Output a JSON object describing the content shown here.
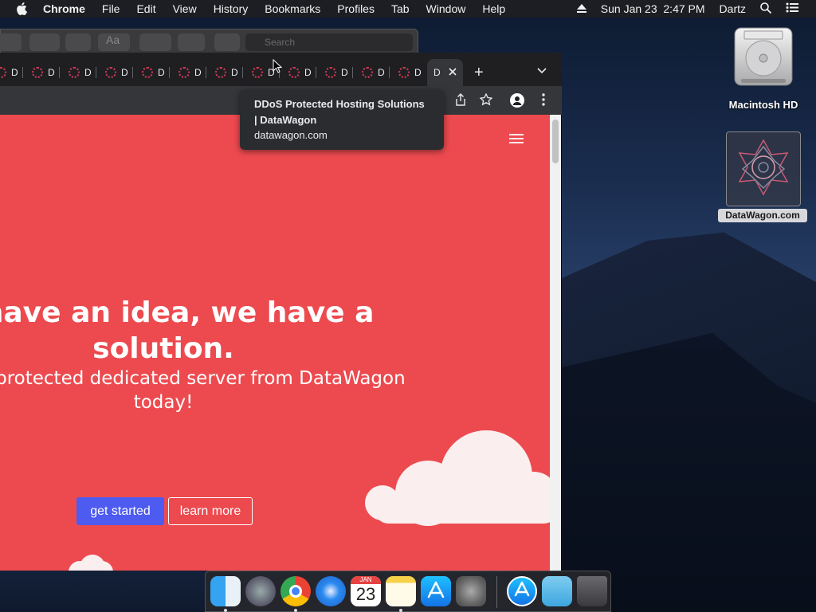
{
  "menubar": {
    "app": "Chrome",
    "items": [
      "File",
      "Edit",
      "View",
      "History",
      "Bookmarks",
      "Profiles",
      "Tab",
      "Window",
      "Help"
    ],
    "clock": "Sun Jan 23  2:47 PM",
    "user": "Dartz"
  },
  "background_window": {
    "search_placeholder": "Search"
  },
  "chrome": {
    "tabs": [
      {
        "label": "D"
      },
      {
        "label": "D"
      },
      {
        "label": "D"
      },
      {
        "label": "D"
      },
      {
        "label": "D"
      },
      {
        "label": "D"
      },
      {
        "label": "D"
      },
      {
        "label": "D"
      },
      {
        "label": "D"
      },
      {
        "label": "D"
      },
      {
        "label": "D"
      },
      {
        "label": "D"
      }
    ],
    "active_tab": {
      "label": "D"
    },
    "new_tab": "+",
    "tooltip": {
      "title": "DDoS Protected Hosting Solutions | DataWagon",
      "url": "datawagon.com"
    }
  },
  "page": {
    "headline": "u have an idea, we have a solution.",
    "subheadline": "a DDoS protected dedicated server from DataWagon today!",
    "get_started": "get started",
    "learn_more": "learn more",
    "colors": {
      "background": "#ec4a4f",
      "primary_button": "#4d5bf0"
    }
  },
  "desktop": {
    "hd_label": "Macintosh HD",
    "file_label": "DataWagon.com"
  },
  "dock": {
    "apps": [
      "Finder",
      "Launchpad",
      "Google Chrome",
      "Safari",
      "Calendar",
      "Notes",
      "App Store",
      "System Preferences",
      "App Store",
      "Downloads",
      "Trash"
    ],
    "calendar_month": "JAN",
    "calendar_day": "23"
  }
}
